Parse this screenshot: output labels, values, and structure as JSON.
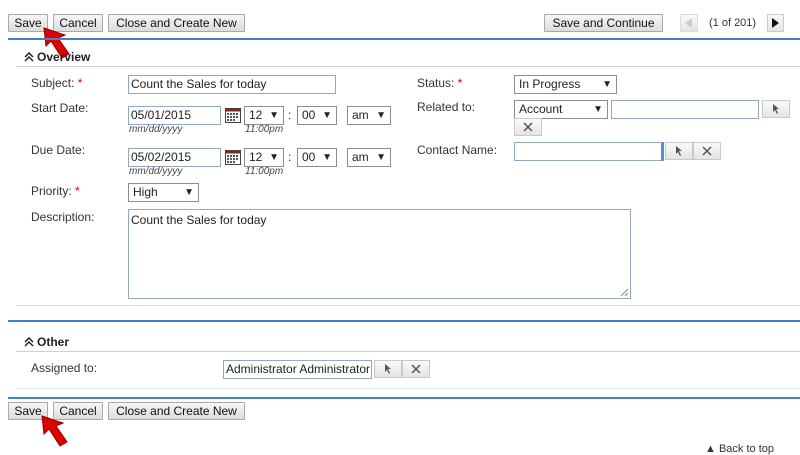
{
  "top_toolbar": {
    "save_label": "Save",
    "cancel_label": "Cancel",
    "close_create_label": "Close and Create New",
    "save_continue_label": "Save and Continue",
    "record_counter": "(1 of 201)"
  },
  "overview": {
    "section_title": "Overview",
    "subject_label": "Subject:",
    "subject_value": "Count the Sales for today",
    "status_label": "Status:",
    "status_value": "In Progress",
    "start_date_label": "Start Date:",
    "start_date_value": "05/01/2015",
    "start_hour": "12",
    "start_minute": "00",
    "start_ampm": "am",
    "start_date_format": "mm/dd/yyyy",
    "start_time_display": "11:00pm",
    "related_to_label": "Related to:",
    "related_to_type": "Account",
    "related_to_value": "",
    "due_date_label": "Due Date:",
    "due_date_value": "05/02/2015",
    "due_hour": "12",
    "due_minute": "00",
    "due_ampm": "am",
    "due_date_format": "mm/dd/yyyy",
    "due_time_display": "11:00pm",
    "contact_name_label": "Contact Name:",
    "contact_name_value": "",
    "priority_label": "Priority:",
    "priority_value": "High",
    "description_label": "Description:",
    "description_value": "Count the Sales for today",
    "time_separator": ":",
    "required_mark": "*"
  },
  "other": {
    "section_title": "Other",
    "assigned_to_label": "Assigned to:",
    "assigned_to_value": "Administrator Administrator"
  },
  "bottom_toolbar": {
    "save_label": "Save",
    "cancel_label": "Cancel",
    "close_create_label": "Close and Create New"
  },
  "footer": {
    "back_to_top_label": "Back to top"
  },
  "colors": {
    "accent_line": "#4a7fc4",
    "pointer_arrow": "#e00000",
    "required": "#dd0000"
  },
  "icons": [
    "calendar-icon",
    "select-pointer-icon",
    "clear-x-icon",
    "collapse-chevron-icon",
    "pointer-arrow-icon",
    "next-record-icon",
    "prev-record-icon"
  ]
}
